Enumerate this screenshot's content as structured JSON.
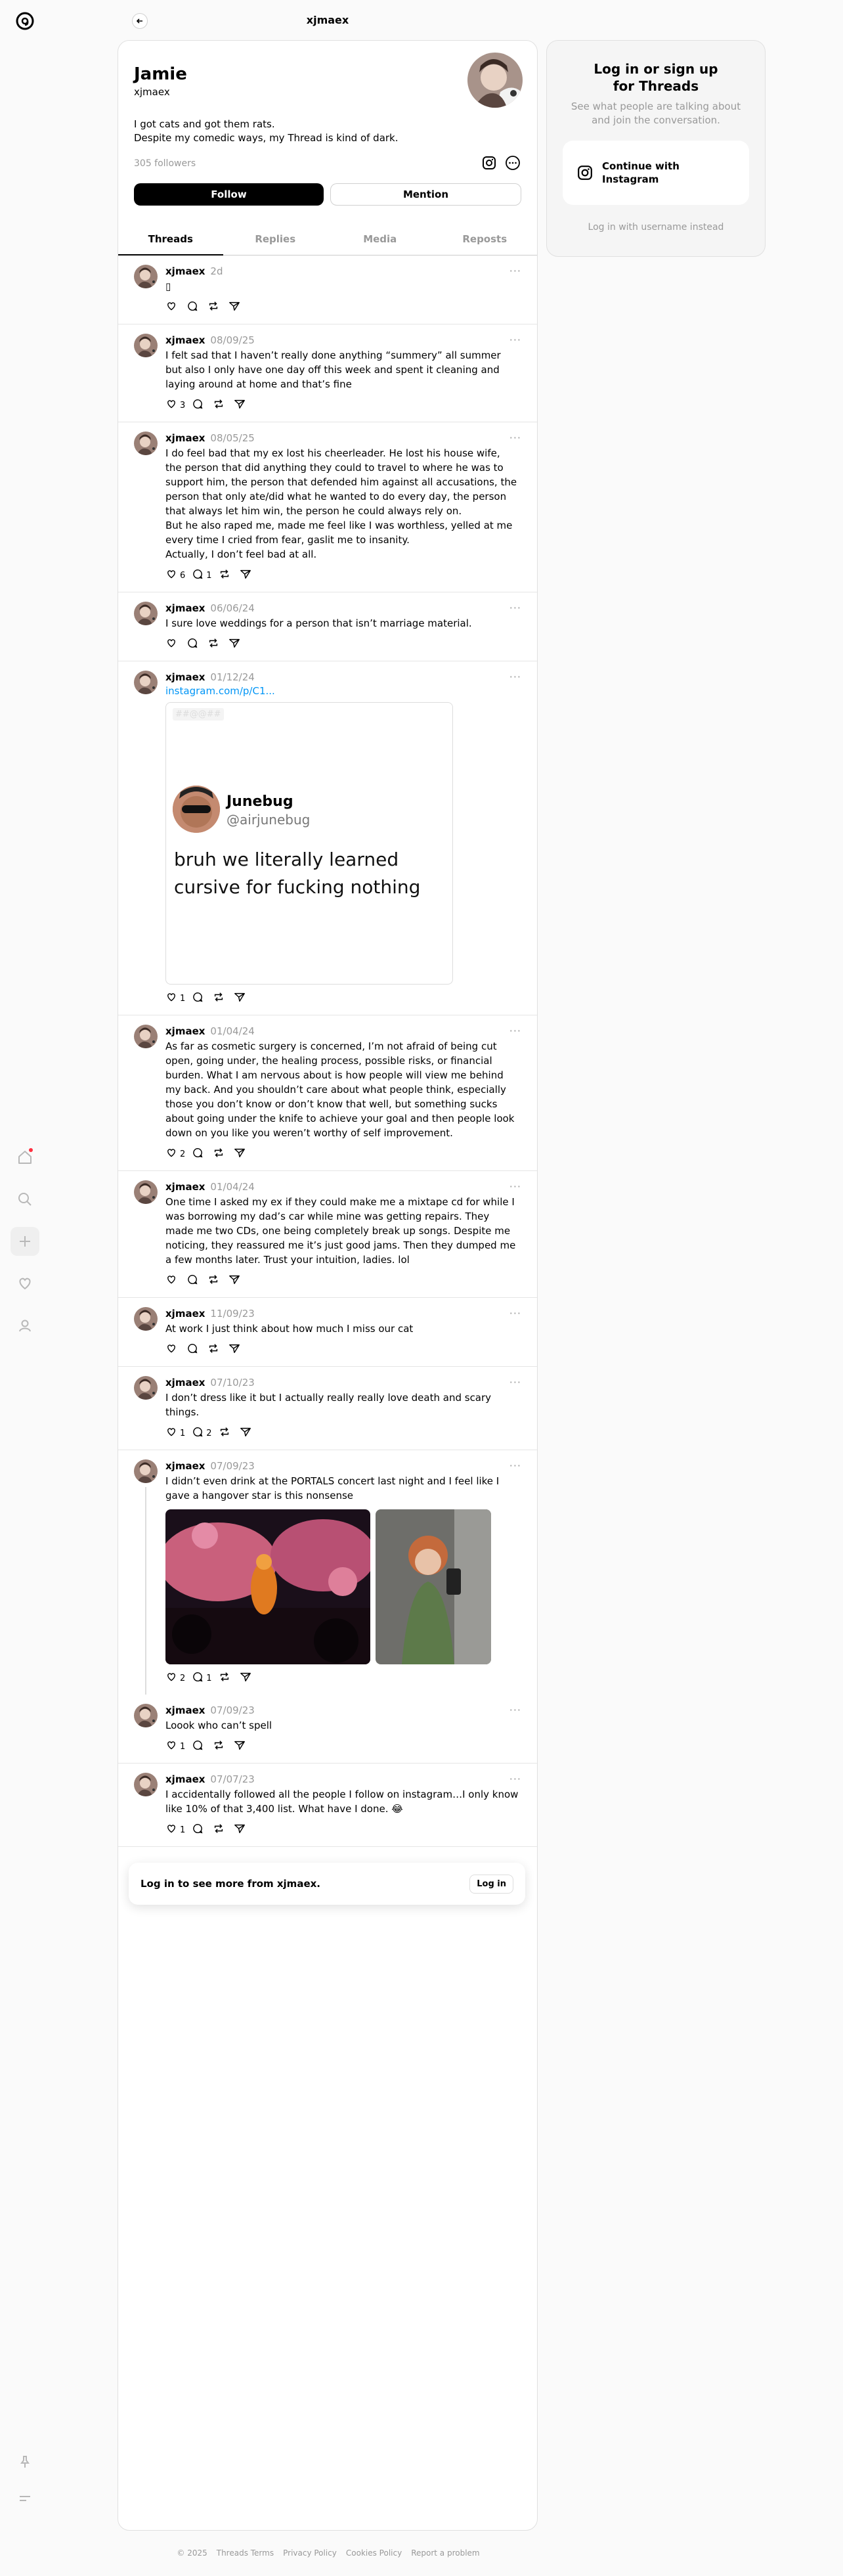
{
  "app": {
    "logo_icon": "threads-logo-icon"
  },
  "header": {
    "title": "xjmaex"
  },
  "profile": {
    "name": "Jamie",
    "handle": "xjmaex",
    "bio_line1": "I got cats and got them rats.",
    "bio_line2": "Despite my comedic ways, my Thread is kind of dark.",
    "followers": "305 followers",
    "follow_label": "Follow",
    "mention_label": "Mention"
  },
  "tabs": [
    {
      "label": "Threads"
    },
    {
      "label": "Replies"
    },
    {
      "label": "Media"
    },
    {
      "label": "Reposts"
    }
  ],
  "posts": [
    {
      "author": "xjmaex",
      "date": "2d",
      "text": "▯",
      "likes": "",
      "replies": ""
    },
    {
      "author": "xjmaex",
      "date": "08/09/25",
      "text": "I felt sad that I haven’t really done anything “summery” all summer but also I only have one day off this week and spent it cleaning and laying around at home and that’s fine",
      "likes": "3",
      "replies": ""
    },
    {
      "author": "xjmaex",
      "date": "08/05/25",
      "text": "I do feel bad that my ex lost his cheerleader. He lost his house wife, the person that did anything they could to travel to where he was to support him, the person that defended him against all accusations, the person that only ate/did what he wanted to do every day, the person that always let him win, the person he could always rely on.\nBut he also raped me, made me feel like I was worthless, yelled at me every time I cried from fear, gaslit me to insanity.\nActually, I don’t feel bad at all.",
      "likes": "6",
      "replies": "1"
    },
    {
      "author": "xjmaex",
      "date": "06/06/24",
      "text": "I sure love weddings for a person that isn’t marriage material.",
      "likes": "",
      "replies": ""
    },
    {
      "author": "xjmaex",
      "date": "01/12/24",
      "link": "instagram.com/p/C1...",
      "likes": "1",
      "replies": "",
      "embed": {
        "blur": "##@@##",
        "name": "Junebug",
        "handle": "@airjunebug",
        "text": "bruh we literally learned cursive for fucking nothing"
      }
    },
    {
      "author": "xjmaex",
      "date": "01/04/24",
      "text": "As far as cosmetic surgery is concerned, I’m not afraid of being cut open, going under, the healing process, possible risks, or financial burden. What I am nervous about is how people will view me behind my back. And you shouldn’t care about what people think, especially those you don’t know or don’t know that well, but something sucks about going under the knife to achieve your goal and then people look down on you like you weren’t worthy of self improvement.",
      "likes": "2",
      "replies": ""
    },
    {
      "author": "xjmaex",
      "date": "01/04/24",
      "text": "One time I asked my ex if they could make me a mixtape cd for while I was borrowing my dad’s car while mine was getting repairs. They made me two CDs, one being completely break up songs. Despite me noticing, they reassured me it’s just good jams. Then they dumped me a few months later. Trust your intuition, ladies. lol",
      "likes": "",
      "replies": ""
    },
    {
      "author": "xjmaex",
      "date": "11/09/23",
      "text": "At work I just think about how much I miss our cat",
      "likes": "",
      "replies": ""
    },
    {
      "author": "xjmaex",
      "date": "07/10/23",
      "text": "I don’t dress like it but I actually really really love death and scary things.",
      "likes": "1",
      "replies": "2"
    },
    {
      "author": "xjmaex",
      "date": "07/09/23",
      "text": "I didn’t even drink at the PORTALS concert last night and I feel like I gave a hangover star is this nonsense",
      "likes": "2",
      "replies": "1"
    },
    {
      "author": "xjmaex",
      "date": "07/09/23",
      "text": "Loook who can’t spell",
      "likes": "1",
      "replies": ""
    },
    {
      "author": "xjmaex",
      "date": "07/07/23",
      "text": "I accidentally followed all the people I follow on instagram…I only know like 10% of that 3,400 list. What have I done. 😂",
      "likes": "1",
      "replies": ""
    }
  ],
  "login_banner": {
    "text": "Log in to see more from xjmaex.",
    "button": "Log in"
  },
  "sidebar": {
    "title_line1": "Log in or sign up",
    "title_line2": "for Threads",
    "subtitle_line1": "See what people are talking about",
    "subtitle_line2": "and join the conversation.",
    "instagram_line1": "Continue with",
    "instagram_line2": "Instagram",
    "username_link": "Log in with username instead"
  },
  "footer": {
    "items": [
      "© 2025",
      "Threads Terms",
      "Privacy Policy",
      "Cookies Policy",
      "Report a problem"
    ]
  },
  "colors": {
    "link": "#0095f6",
    "notification": "#ff3040",
    "muted": "#999999"
  }
}
